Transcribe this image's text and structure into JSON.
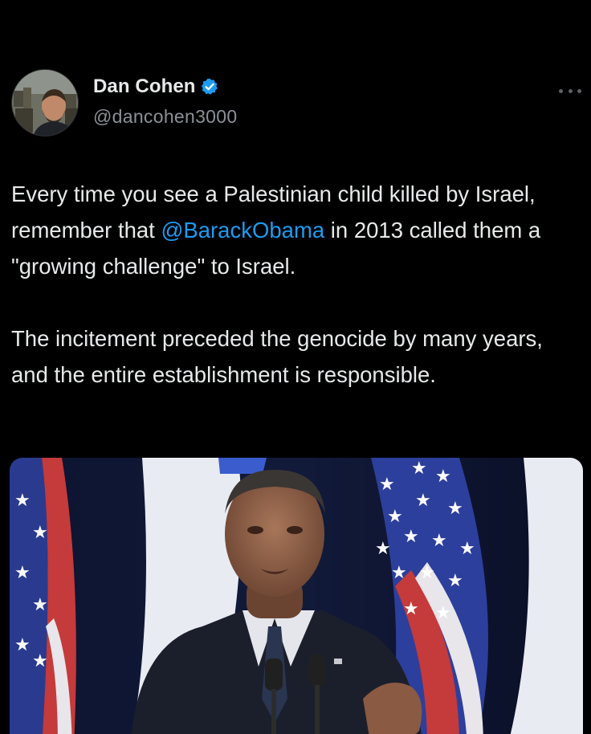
{
  "author": {
    "display_name": "Dan Cohen",
    "handle": "@dancohen3000",
    "verified": true,
    "avatar_icon": "avatar-photo"
  },
  "tweet": {
    "paragraph1": {
      "before": "Every time you see a Palestinian child killed by Israel, remember that ",
      "mention": "@BarackObama",
      "after": " in 2013 called them a \"growing challenge\" to Israel."
    },
    "paragraph2": "The incitement preceded the genocide by many years, and the entire establishment is responsible."
  },
  "colors": {
    "background": "#000000",
    "text": "#e7e9ea",
    "handle": "#8b9198",
    "mention": "#1d9bf0",
    "verified": "#1d9bf0"
  },
  "icons": [
    "verified-badge-icon",
    "more-options-icon"
  ]
}
